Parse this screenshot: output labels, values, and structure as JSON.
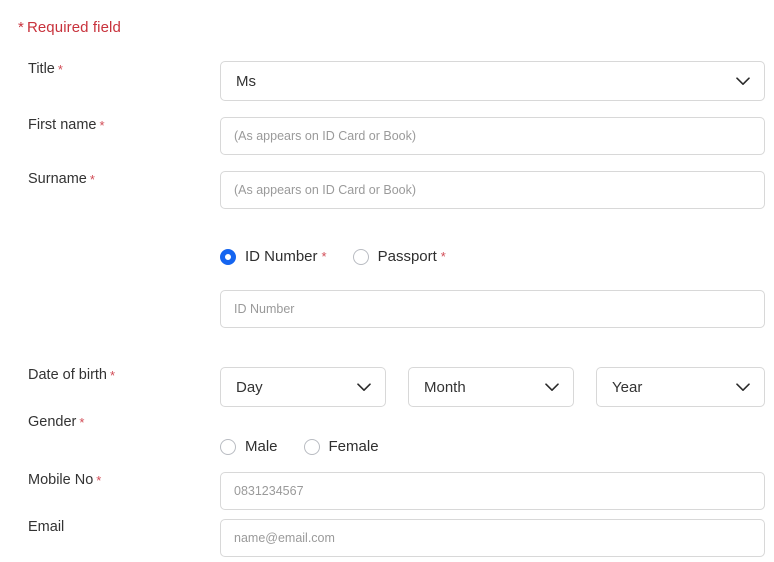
{
  "notice": {
    "asterisk": "*",
    "text": "Required field"
  },
  "colors": {
    "required_red": "#c8323c",
    "asterisk_red": "#d14b55",
    "label_gray": "#333333",
    "placeholder_gray": "#9a9a9a",
    "border_gray": "#d8d8d8",
    "radio_selected_blue": "#1565f0",
    "radio_unselected_gray": "#b9bcc2"
  },
  "fields": {
    "title": {
      "label": "Title",
      "required_mark": "*",
      "value": "Ms",
      "control": "select",
      "icon": "chevron-down-icon"
    },
    "first_name": {
      "label": "First name",
      "required_mark": "*",
      "placeholder": "(As appears on ID Card or Book)",
      "value": "",
      "control": "text"
    },
    "surname": {
      "label": "Surname",
      "required_mark": "*",
      "placeholder": "(As appears on ID Card or Book)",
      "value": "",
      "control": "text"
    },
    "id_type": {
      "label": "",
      "control": "radio-group",
      "options": [
        {
          "label": "ID Number",
          "required_mark": "*",
          "selected": true
        },
        {
          "label": "Passport",
          "required_mark": "*",
          "selected": false
        }
      ]
    },
    "id_number": {
      "label": "",
      "placeholder": "ID Number",
      "value": "",
      "control": "text"
    },
    "date_of_birth": {
      "label": "Date of birth",
      "required_mark": "*",
      "control": "select-trio",
      "day": {
        "value": "Day",
        "icon": "chevron-down-icon"
      },
      "month": {
        "value": "Month",
        "icon": "chevron-down-icon"
      },
      "year": {
        "value": "Year",
        "icon": "chevron-down-icon"
      }
    },
    "gender": {
      "label": "Gender",
      "required_mark": "*",
      "control": "radio-group",
      "options": [
        {
          "label": "Male",
          "selected": false
        },
        {
          "label": "Female",
          "selected": false
        }
      ]
    },
    "mobile_no": {
      "label": "Mobile No",
      "required_mark": "*",
      "placeholder": "0831234567",
      "value": "",
      "control": "text"
    },
    "email": {
      "label": "Email",
      "required_mark": "",
      "placeholder": "name@email.com",
      "value": "",
      "control": "text"
    }
  }
}
